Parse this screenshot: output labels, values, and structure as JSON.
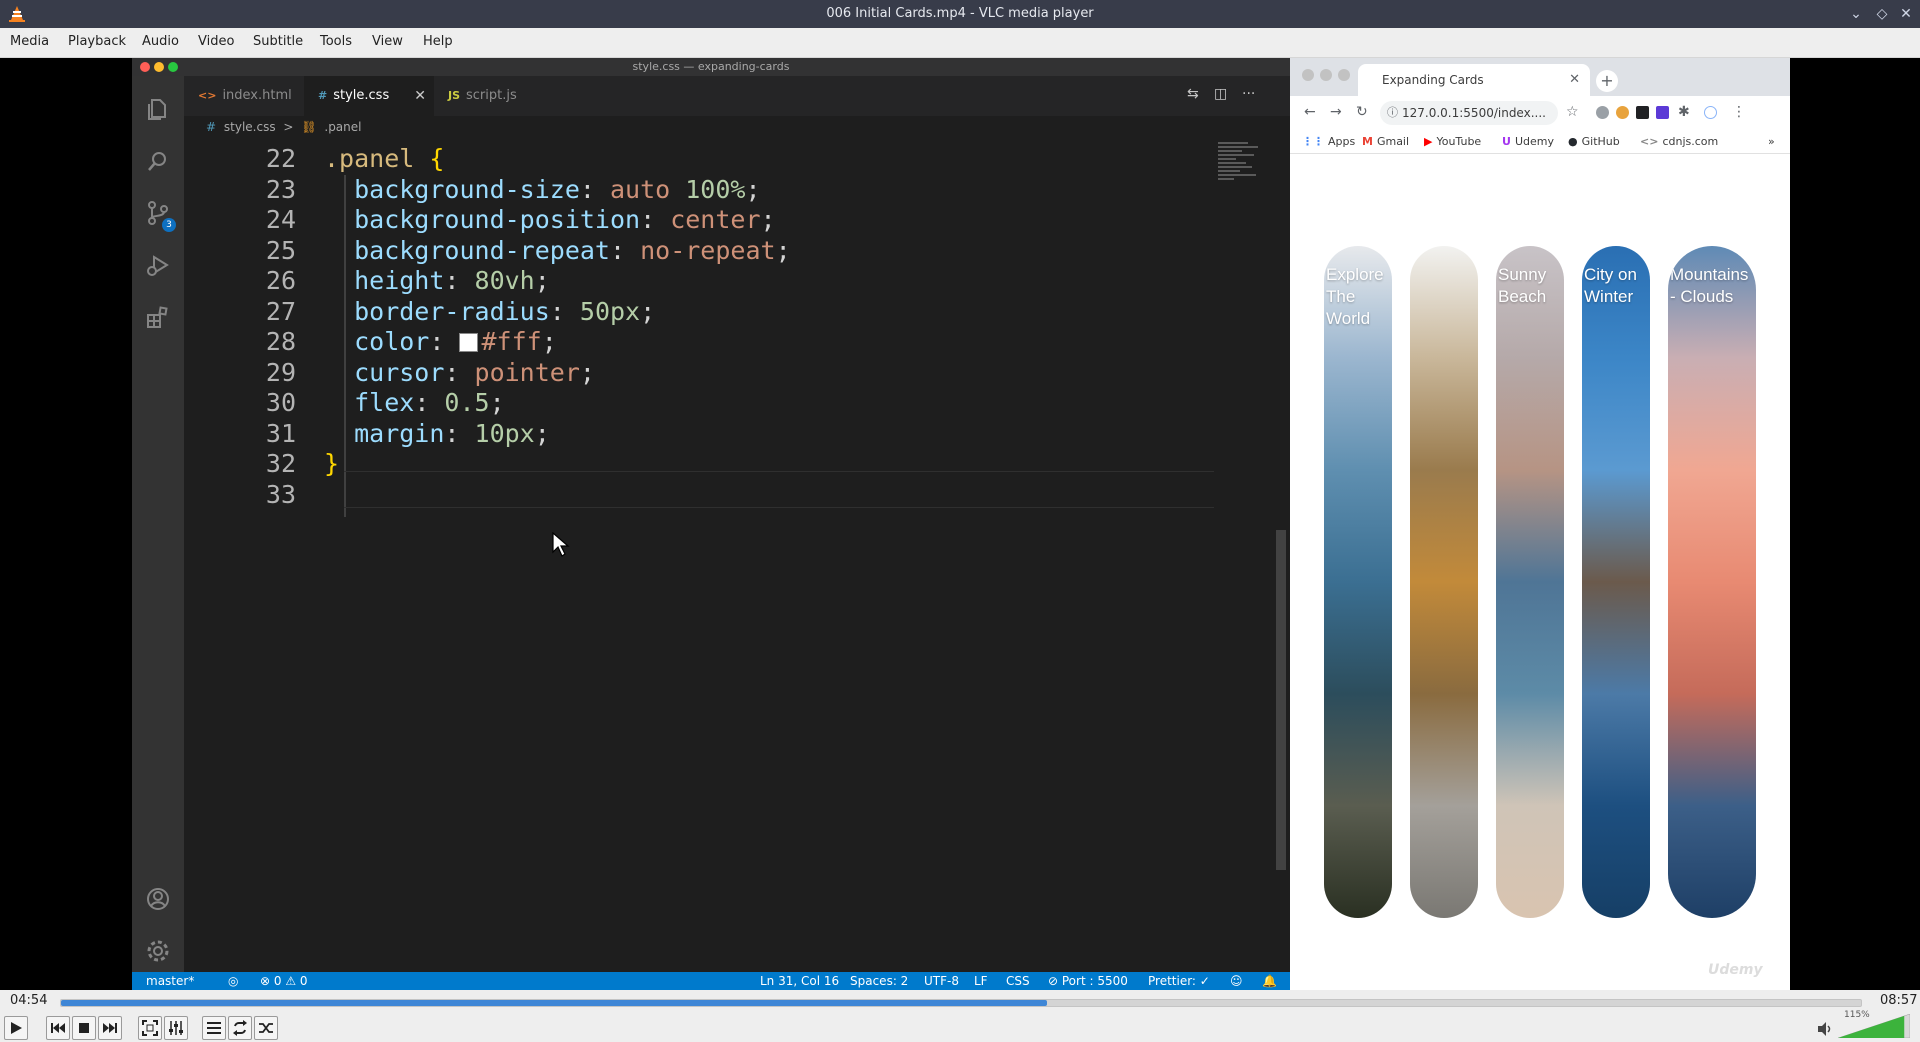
{
  "window": {
    "title": "006 Initial Cards.mp4 - VLC media player",
    "min_icon": "minimize-icon",
    "max_icon": "maximize-icon",
    "close_icon": "close-icon"
  },
  "menu": [
    "Media",
    "Playback",
    "Audio",
    "Video",
    "Subtitle",
    "Tools",
    "View",
    "Help"
  ],
  "vscode": {
    "window_title": "style.css — expanding-cards",
    "tabs": [
      {
        "label": "index.html",
        "icon": "<>",
        "active": false
      },
      {
        "label": "style.css",
        "icon": "#",
        "active": true
      },
      {
        "label": "script.js",
        "icon": "JS",
        "active": false
      }
    ],
    "breadcrumb": [
      "#",
      "style.css",
      ">",
      ".panel"
    ],
    "source_control_badge": "3",
    "code_lines": [
      {
        "n": "22",
        "parts": [
          {
            "t": ".panel ",
            "c": "sel"
          },
          {
            "t": "{",
            "c": "brace"
          }
        ]
      },
      {
        "n": "23",
        "parts": [
          {
            "t": "  background-size",
            "c": "prop"
          },
          {
            "t": ": ",
            "c": "punc"
          },
          {
            "t": "auto ",
            "c": "val"
          },
          {
            "t": "100%",
            "c": "num"
          },
          {
            "t": ";",
            "c": "punc"
          }
        ]
      },
      {
        "n": "24",
        "parts": [
          {
            "t": "  background-position",
            "c": "prop"
          },
          {
            "t": ": ",
            "c": "punc"
          },
          {
            "t": "center",
            "c": "val"
          },
          {
            "t": ";",
            "c": "punc"
          }
        ]
      },
      {
        "n": "25",
        "parts": [
          {
            "t": "  background-repeat",
            "c": "prop"
          },
          {
            "t": ": ",
            "c": "punc"
          },
          {
            "t": "no-repeat",
            "c": "val"
          },
          {
            "t": ";",
            "c": "punc"
          }
        ]
      },
      {
        "n": "26",
        "parts": [
          {
            "t": "  height",
            "c": "prop"
          },
          {
            "t": ": ",
            "c": "punc"
          },
          {
            "t": "80vh",
            "c": "num"
          },
          {
            "t": ";",
            "c": "punc"
          }
        ]
      },
      {
        "n": "27",
        "parts": [
          {
            "t": "  border-radius",
            "c": "prop"
          },
          {
            "t": ": ",
            "c": "punc"
          },
          {
            "t": "50px",
            "c": "num"
          },
          {
            "t": ";",
            "c": "punc"
          }
        ]
      },
      {
        "n": "28",
        "parts": [
          {
            "t": "  color",
            "c": "prop"
          },
          {
            "t": ": ",
            "c": "punc"
          },
          {
            "t": "",
            "c": "swatch"
          },
          {
            "t": "#fff",
            "c": "val"
          },
          {
            "t": ";",
            "c": "punc"
          }
        ]
      },
      {
        "n": "29",
        "parts": [
          {
            "t": "  cursor",
            "c": "prop"
          },
          {
            "t": ": ",
            "c": "punc"
          },
          {
            "t": "pointer",
            "c": "val"
          },
          {
            "t": ";",
            "c": "punc"
          }
        ]
      },
      {
        "n": "30",
        "parts": [
          {
            "t": "  flex",
            "c": "prop"
          },
          {
            "t": ": ",
            "c": "punc"
          },
          {
            "t": "0.5",
            "c": "num"
          },
          {
            "t": ";",
            "c": "punc"
          }
        ]
      },
      {
        "n": "31",
        "parts": [
          {
            "t": "  margin",
            "c": "prop"
          },
          {
            "t": ": ",
            "c": "punc"
          },
          {
            "t": "10px",
            "c": "num"
          },
          {
            "t": ";",
            "c": "punc"
          }
        ]
      },
      {
        "n": "32",
        "parts": [
          {
            "t": "}",
            "c": "brace"
          }
        ]
      },
      {
        "n": "33",
        "parts": []
      }
    ],
    "status": {
      "branch": "master*",
      "errors": "⊗ 0 ⚠ 0",
      "position": "Ln 31, Col 16",
      "spaces": "Spaces: 2",
      "encoding": "UTF-8",
      "eol": "LF",
      "language": "CSS",
      "port": "⊘ Port : 5500",
      "prettier": "Prettier: ✓"
    }
  },
  "browser": {
    "tab_title": "Expanding Cards",
    "url": "127.0.0.1:5500/index....",
    "bookmarks": [
      {
        "label": "Apps",
        "icon": "⋮⋮"
      },
      {
        "label": "Gmail",
        "icon": "M"
      },
      {
        "label": "YouTube",
        "icon": "▶"
      },
      {
        "label": "Udemy",
        "icon": "U"
      },
      {
        "label": "GitHub",
        "icon": "●"
      },
      {
        "label": "cdnjs.com",
        "icon": "<>"
      }
    ],
    "more_bookmarks": "»",
    "panels": [
      {
        "title": "Explore\nThe\nWorld",
        "colors": [
          "#e7e9ec",
          "#9bb6cf",
          "#5f8fb0",
          "#3b6f92",
          "#2c4d5c",
          "#5a5d50",
          "#2a3022"
        ]
      },
      {
        "title": "",
        "colors": [
          "#f2f2f0",
          "#c9b79a",
          "#9a7b4d",
          "#c28a3a",
          "#8a6b3f",
          "#a4a09a",
          "#7a7873"
        ]
      },
      {
        "title": "Sunny\nBeach",
        "colors": [
          "#c8c3c7",
          "#b5a9a9",
          "#b69484",
          "#4f7596",
          "#5d8ba7",
          "#cfc4b7",
          "#d9c4b0"
        ]
      },
      {
        "title": "City on\nWinter",
        "colors": [
          "#2a6fb3",
          "#3c86c7",
          "#5b9ad1",
          "#6b5a4c",
          "#4c7aa7",
          "#1d4f80",
          "#163f66"
        ]
      },
      {
        "title": "Mountains\n- Clouds",
        "colors": [
          "#5f8ab5",
          "#c9aeb3",
          "#f0a792",
          "#e88a72",
          "#c56b5a",
          "#3c5f88",
          "#1e3f66"
        ]
      }
    ],
    "watermark": "Udemy"
  },
  "player": {
    "elapsed": "04:54",
    "total": "08:57",
    "progress": 0.5475,
    "volume_label": "115%",
    "volume_level": 1.15
  }
}
